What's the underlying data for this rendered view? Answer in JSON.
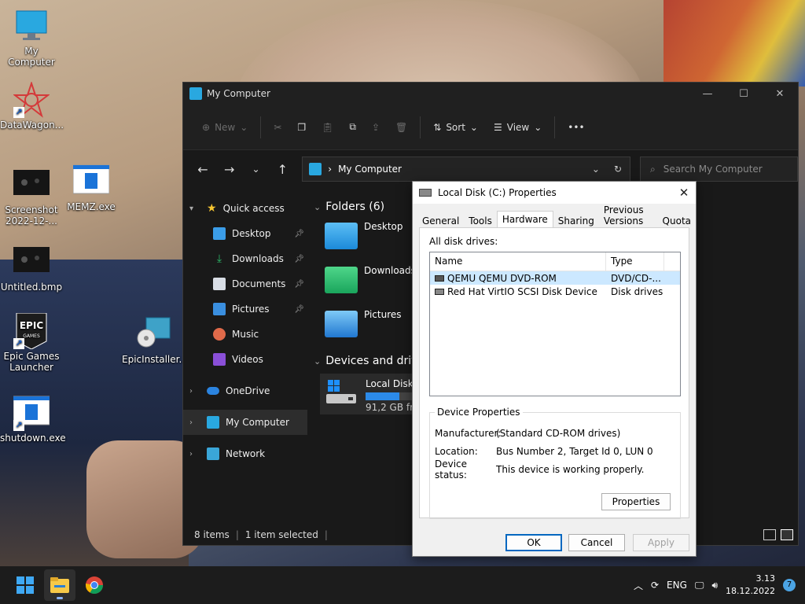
{
  "desktop": {
    "icons": [
      {
        "label": "My Computer"
      },
      {
        "label": "DataWagon..."
      },
      {
        "label": "Screenshot 2022-12-..."
      },
      {
        "label": "MEMZ.exe"
      },
      {
        "label": "Untitled.bmp"
      },
      {
        "label": "Epic Games Launcher"
      },
      {
        "label": "EpicInstaller..."
      },
      {
        "label": "shutdown.exe"
      }
    ]
  },
  "explorer": {
    "title": "My Computer",
    "toolbar": {
      "new": "New",
      "sort": "Sort",
      "view": "View",
      "more": "•••"
    },
    "address": {
      "path": "My Computer",
      "search_placeholder": "Search My Computer"
    },
    "nav": {
      "quick_access": "Quick access",
      "items": [
        "Desktop",
        "Downloads",
        "Documents",
        "Pictures",
        "Music",
        "Videos"
      ],
      "onedrive": "OneDrive",
      "my_computer": "My Computer",
      "network": "Network"
    },
    "content": {
      "folders_header": "Folders (6)",
      "folders": [
        "Desktop",
        "Downloads",
        "Pictures"
      ],
      "devices_header": "Devices and drives",
      "drive_name": "Local Disk (",
      "drive_free": "91,2 GB free",
      "drive_used_fraction": 0.72
    },
    "status": {
      "items": "8 items",
      "selected": "1 item selected"
    }
  },
  "props": {
    "title": "Local Disk (C:) Properties",
    "tabs": [
      "General",
      "Tools",
      "Hardware",
      "Sharing",
      "Previous Versions",
      "Quota"
    ],
    "active_tab": "Hardware",
    "all_drives_label": "All disk drives:",
    "columns": [
      "Name",
      "Type"
    ],
    "rows": [
      {
        "name": "QEMU QEMU DVD-ROM",
        "type": "DVD/CD-..."
      },
      {
        "name": "Red Hat VirtIO SCSI Disk Device",
        "type": "Disk drives"
      }
    ],
    "device_props": {
      "label": "Device Properties",
      "manufacturer_k": "Manufacturer:",
      "manufacturer_v": "(Standard CD-ROM drives)",
      "location_k": "Location:",
      "location_v": "Bus Number 2, Target Id 0, LUN 0",
      "status_k": "Device status:",
      "status_v": "This device is working properly.",
      "properties_btn": "Properties"
    },
    "buttons": {
      "ok": "OK",
      "cancel": "Cancel",
      "apply": "Apply"
    }
  },
  "taskbar": {
    "language": "ENG",
    "time": "3.13",
    "date": "18.12.2022",
    "notifications": "7"
  }
}
